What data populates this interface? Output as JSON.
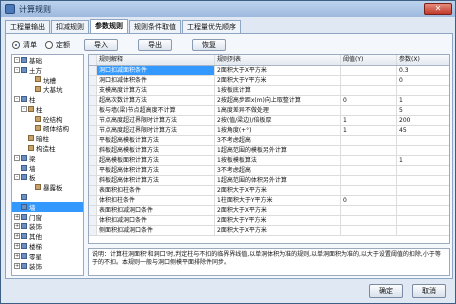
{
  "window": {
    "title": "计算规则",
    "close_label": "✕"
  },
  "tabs": [
    "工程量输出",
    "扣减规则",
    "参数规则",
    "规则条件取值",
    "工程量优先顺序"
  ],
  "active_tab": 2,
  "filter": {
    "options": [
      "清单",
      "定额"
    ],
    "selected": 0
  },
  "toolbar": {
    "import": "导入",
    "export": "导出",
    "restore": "恢复"
  },
  "tree": [
    {
      "label": "基础",
      "level": 0,
      "exp": "-"
    },
    {
      "label": "土方",
      "level": 0,
      "exp": "-"
    },
    {
      "label": "坑槽",
      "level": 2,
      "exp": ""
    },
    {
      "label": "大基坑",
      "level": 2,
      "exp": ""
    },
    {
      "label": "柱",
      "level": 0,
      "exp": "-"
    },
    {
      "label": "柱",
      "level": 1,
      "exp": "-"
    },
    {
      "label": "砼结构",
      "level": 2,
      "exp": ""
    },
    {
      "label": "砌体结构",
      "level": 2,
      "exp": ""
    },
    {
      "label": "暗柱",
      "level": 1,
      "exp": ""
    },
    {
      "label": "构造柱",
      "level": 1,
      "exp": ""
    },
    {
      "label": "梁",
      "level": 0,
      "exp": "-"
    },
    {
      "label": "墙",
      "level": 0,
      "exp": ""
    },
    {
      "label": "板",
      "level": 0,
      "exp": "-"
    },
    {
      "label": "暴露板",
      "level": 2,
      "exp": ""
    },
    {
      "label": "",
      "level": 0,
      "exp": ""
    },
    {
      "label": "墙",
      "level": 0,
      "exp": "",
      "selected": true
    },
    {
      "label": "门窗",
      "level": 0,
      "exp": "+"
    },
    {
      "label": "装饰",
      "level": 0,
      "exp": "+"
    },
    {
      "label": "其他",
      "level": 0,
      "exp": "+"
    },
    {
      "label": "楼梯",
      "level": 0,
      "exp": "+"
    },
    {
      "label": "零星",
      "level": 0,
      "exp": "+"
    },
    {
      "label": "装饰",
      "level": 0,
      "exp": "+"
    }
  ],
  "table": {
    "columns": [
      "规则解释",
      "规则列表",
      "阈值(Y)",
      "参数(X)"
    ],
    "rows": [
      {
        "desc": "洞口扣减面积条件",
        "rule": "2面积大于X平方米",
        "y": "",
        "x": "0.3",
        "selected": true
      },
      {
        "desc": "洞口扣减体积条件",
        "rule": "2面积大于Y平方米",
        "y": "",
        "x": "0",
        "selected": false
      },
      {
        "desc": "支模高度计算方法",
        "rule": "1按板底计算",
        "y": "",
        "x": "",
        "selected": false
      },
      {
        "desc": "超高次数计算方法",
        "rule": "2按超高步距x(m)向上取整计算",
        "y": "0",
        "x": "1",
        "selected": false
      },
      {
        "desc": "板与墙(梁)节点超高度不计算",
        "rule": "1高度差异不做处理",
        "y": "",
        "x": "5",
        "selected": false
      },
      {
        "desc": "节点高度超过界限时计算方法",
        "rule": "2按(值/梁边)/倍板厚",
        "y": "1",
        "x": "200",
        "selected": false
      },
      {
        "desc": "节点高度超过界限时计算方法",
        "rule": "1按角度(+°)",
        "y": "1",
        "x": "45",
        "selected": false
      },
      {
        "desc": "平板超高模板计算方法",
        "rule": "3不考虑超高",
        "y": "",
        "x": "",
        "selected": false
      },
      {
        "desc": "斜板超高模板计算方法",
        "rule": "1超高范围的模板另外计算",
        "y": "",
        "x": "",
        "selected": false
      },
      {
        "desc": "超高模板面积计算方法",
        "rule": "1按板模板算法",
        "y": "",
        "x": "1",
        "selected": false
      },
      {
        "desc": "平板超高体积计算方法",
        "rule": "3不考虑超高",
        "y": "",
        "x": "",
        "selected": false
      },
      {
        "desc": "斜板超高体积计算方法",
        "rule": "1超高范围的体积另外计算",
        "y": "",
        "x": "",
        "selected": false
      },
      {
        "desc": "表面积扣柱条件",
        "rule": "2面积大于X平方米",
        "y": "",
        "x": "",
        "selected": false
      },
      {
        "desc": "体积扣柱条件",
        "rule": "1柱面积大于Y平方米",
        "y": "0",
        "x": "",
        "selected": false
      },
      {
        "desc": "表面积扣减洞口条件",
        "rule": "2面积大于X平方米",
        "y": "",
        "x": "",
        "selected": false
      },
      {
        "desc": "体积扣减洞口条件",
        "rule": "2面积大于Y平方米",
        "y": "",
        "x": "",
        "selected": false
      },
      {
        "desc": "侧面积扣减洞口条件",
        "rule": "2面积大于X平方米",
        "y": "",
        "x": "",
        "selected": false
      }
    ]
  },
  "note": "说明：计算柱洞面积'和洞口'时,判定柱与不扣的临界界线值,以单洞体积为准的规则,以单洞面积为准的,以大于设置阈值的扣除,小于等于的不扣。本规则一般与洞口侧模平面排除件同步。",
  "buttons": {
    "ok": "确定",
    "cancel": "取消"
  }
}
